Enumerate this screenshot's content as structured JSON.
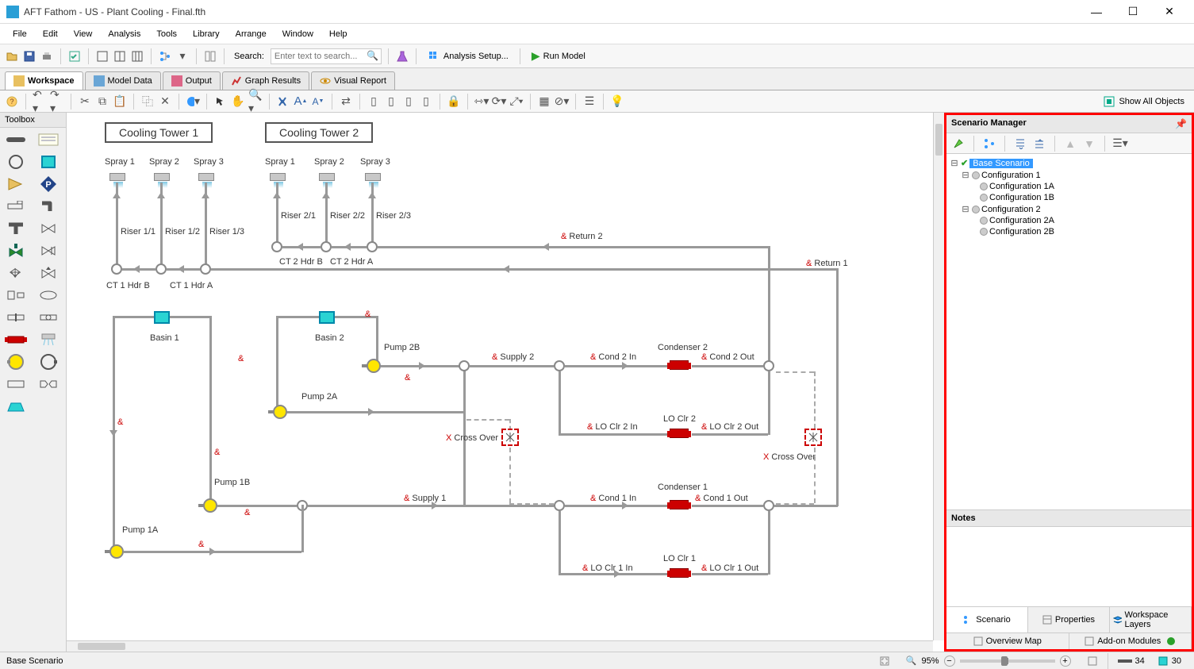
{
  "title": "AFT Fathom - US - Plant Cooling - Final.fth",
  "menu": [
    "File",
    "Edit",
    "View",
    "Analysis",
    "Tools",
    "Library",
    "Arrange",
    "Window",
    "Help"
  ],
  "search": {
    "label": "Search:",
    "placeholder": "Enter text to search..."
  },
  "analysis_setup": "Analysis Setup...",
  "run_model": "Run Model",
  "tabs": {
    "workspace": "Workspace",
    "model_data": "Model Data",
    "output": "Output",
    "graph_results": "Graph Results",
    "visual_report": "Visual Report"
  },
  "show_all_objects": "Show All Objects",
  "toolbox_header": "Toolbox",
  "scenario": {
    "header": "Scenario Manager",
    "base": "Base Scenario",
    "config1": "Configuration 1",
    "config1a": "Configuration 1A",
    "config1b": "Configuration 1B",
    "config2": "Configuration 2",
    "config2a": "Configuration 2A",
    "config2b": "Configuration 2B",
    "notes_header": "Notes",
    "tabs": {
      "scenario": "Scenario",
      "properties": "Properties",
      "layers": "Workspace Layers"
    },
    "bottom": {
      "overview": "Overview Map",
      "addon": "Add-on Modules"
    }
  },
  "status": {
    "scenario_name": "Base Scenario",
    "zoom": "95%",
    "pipes": "34",
    "junctions": "30"
  },
  "diagram": {
    "cooling_tower_1": "Cooling Tower 1",
    "cooling_tower_2": "Cooling Tower 2",
    "spray1": "Spray 1",
    "spray2": "Spray 2",
    "spray3": "Spray 3",
    "spray1b": "Spray 1",
    "spray2b": "Spray 2",
    "spray3b": "Spray 3",
    "riser11": "Riser 1/1",
    "riser12": "Riser 1/2",
    "riser13": "Riser 1/3",
    "riser21": "Riser 2/1",
    "riser22": "Riser 2/2",
    "riser23": "Riser 2/3",
    "ct1hdra": "CT 1 Hdr A",
    "ct1hdrb": "CT 1 Hdr B",
    "ct2hdra": "CT 2 Hdr A",
    "ct2hdrb": "CT 2 Hdr B",
    "basin1": "Basin 1",
    "basin2": "Basin 2",
    "pump1a": "Pump 1A",
    "pump1b": "Pump 1B",
    "pump2a": "Pump 2A",
    "pump2b": "Pump 2B",
    "supply1": "Supply 1",
    "supply2": "Supply 2",
    "return1": "Return 1",
    "return2": "Return 2",
    "cond1in": "Cond 1 In",
    "cond1out": "Cond 1 Out",
    "cond2in": "Cond 2 In",
    "cond2out": "Cond 2 Out",
    "condenser1": "Condenser 1",
    "condenser2": "Condenser 2",
    "loclr1": "LO Clr 1",
    "loclr2": "LO Clr 2",
    "loclr1in": "LO Clr 1 In",
    "loclr1out": "LO Clr 1 Out",
    "loclr2in": "LO Clr 2 In",
    "loclr2out": "LO Clr 2 Out",
    "crossover": "Cross Over",
    "crossover2": "Cross Over",
    "x": "X",
    "amp": "&"
  }
}
